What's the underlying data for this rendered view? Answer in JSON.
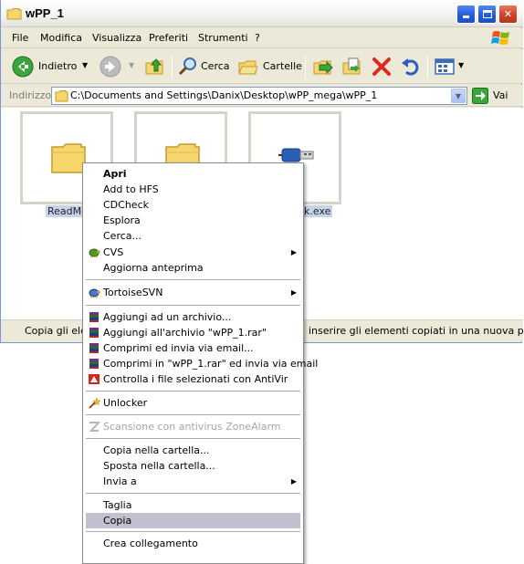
{
  "window": {
    "title": "wPP_1"
  },
  "menu": [
    "File",
    "Modifica",
    "Visualizza",
    "Preferiti",
    "Strumenti",
    "?"
  ],
  "toolbar": {
    "back_label": "Indietro",
    "search_label": "Cerca",
    "folders_label": "Cartelle"
  },
  "address": {
    "label": "Indirizzo",
    "path": "C:\\Documents and Settings\\Danix\\Desktop\\wPP_mega\\wPP_1",
    "go_label": "Vai"
  },
  "files": [
    {
      "name": "ReadMe",
      "icon": "folder-icon"
    },
    {
      "name": "",
      "icon": "folder-icon"
    },
    {
      "name": "k.exe",
      "icon": "usb-plug-icon"
    }
  ],
  "status": {
    "left": "Copia gli elem",
    "right": "inserire gli elementi copiati in una nuova posiz"
  },
  "context_menu": {
    "groups": [
      [
        "Apri",
        "Add to HFS",
        "CDCheck",
        "Esplora",
        "Cerca...",
        "CVS",
        "Aggiorna anteprima"
      ],
      [
        "TortoiseSVN"
      ],
      [
        "Aggiungi ad un archivio...",
        "Aggiungi all'archivio \"wPP_1.rar\"",
        "Comprimi ed invia via email...",
        "Comprimi in \"wPP_1.rar\" ed invia via email",
        "Controlla i file selezionati con AntiVir"
      ],
      [
        "Unlocker"
      ],
      [
        "Scansione con antivirus ZoneAlarm"
      ],
      [
        "Copia nella cartella...",
        "Sposta nella cartella...",
        "Invia a"
      ],
      [
        "Taglia",
        "Copia"
      ],
      [
        "Crea collegamento"
      ]
    ],
    "highlighted": "Copia"
  },
  "colors": {
    "title_gradient_top": "#ffffff",
    "menu_highlight": "#c1c0cf",
    "selection": "#c8d3e7"
  }
}
